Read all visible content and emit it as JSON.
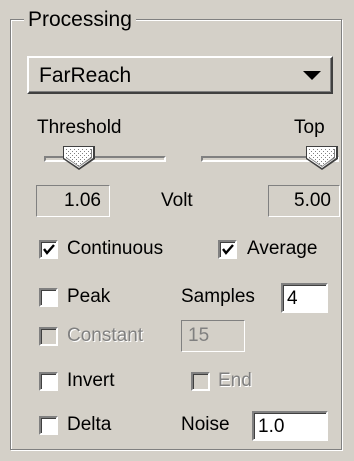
{
  "panel": {
    "title": "Processing"
  },
  "mode_select": {
    "value": "FarReach"
  },
  "sliders": {
    "threshold": {
      "label": "Threshold",
      "value": "1.06",
      "level": 0.21
    },
    "top": {
      "label": "Top",
      "value": "5.00",
      "level": 1.0
    },
    "unit": "Volt"
  },
  "options": {
    "continuous": {
      "label": "Continuous",
      "checked": true
    },
    "average": {
      "label": "Average",
      "checked": true
    },
    "peak": {
      "label": "Peak",
      "checked": false
    },
    "samples": {
      "label": "Samples",
      "value": "4"
    },
    "constant": {
      "label": "Constant",
      "checked": false,
      "enabled": false
    },
    "constant_value": "15",
    "invert": {
      "label": "Invert",
      "checked": false
    },
    "end": {
      "label": "End",
      "checked": false,
      "enabled": false
    },
    "delta": {
      "label": "Delta",
      "checked": false
    },
    "noise": {
      "label": "Noise",
      "value": "1.0"
    }
  },
  "colors": {
    "face": "#d4d0c8",
    "shadow": "#808080",
    "highlight": "#ffffff",
    "disabled_text": "#808080"
  }
}
